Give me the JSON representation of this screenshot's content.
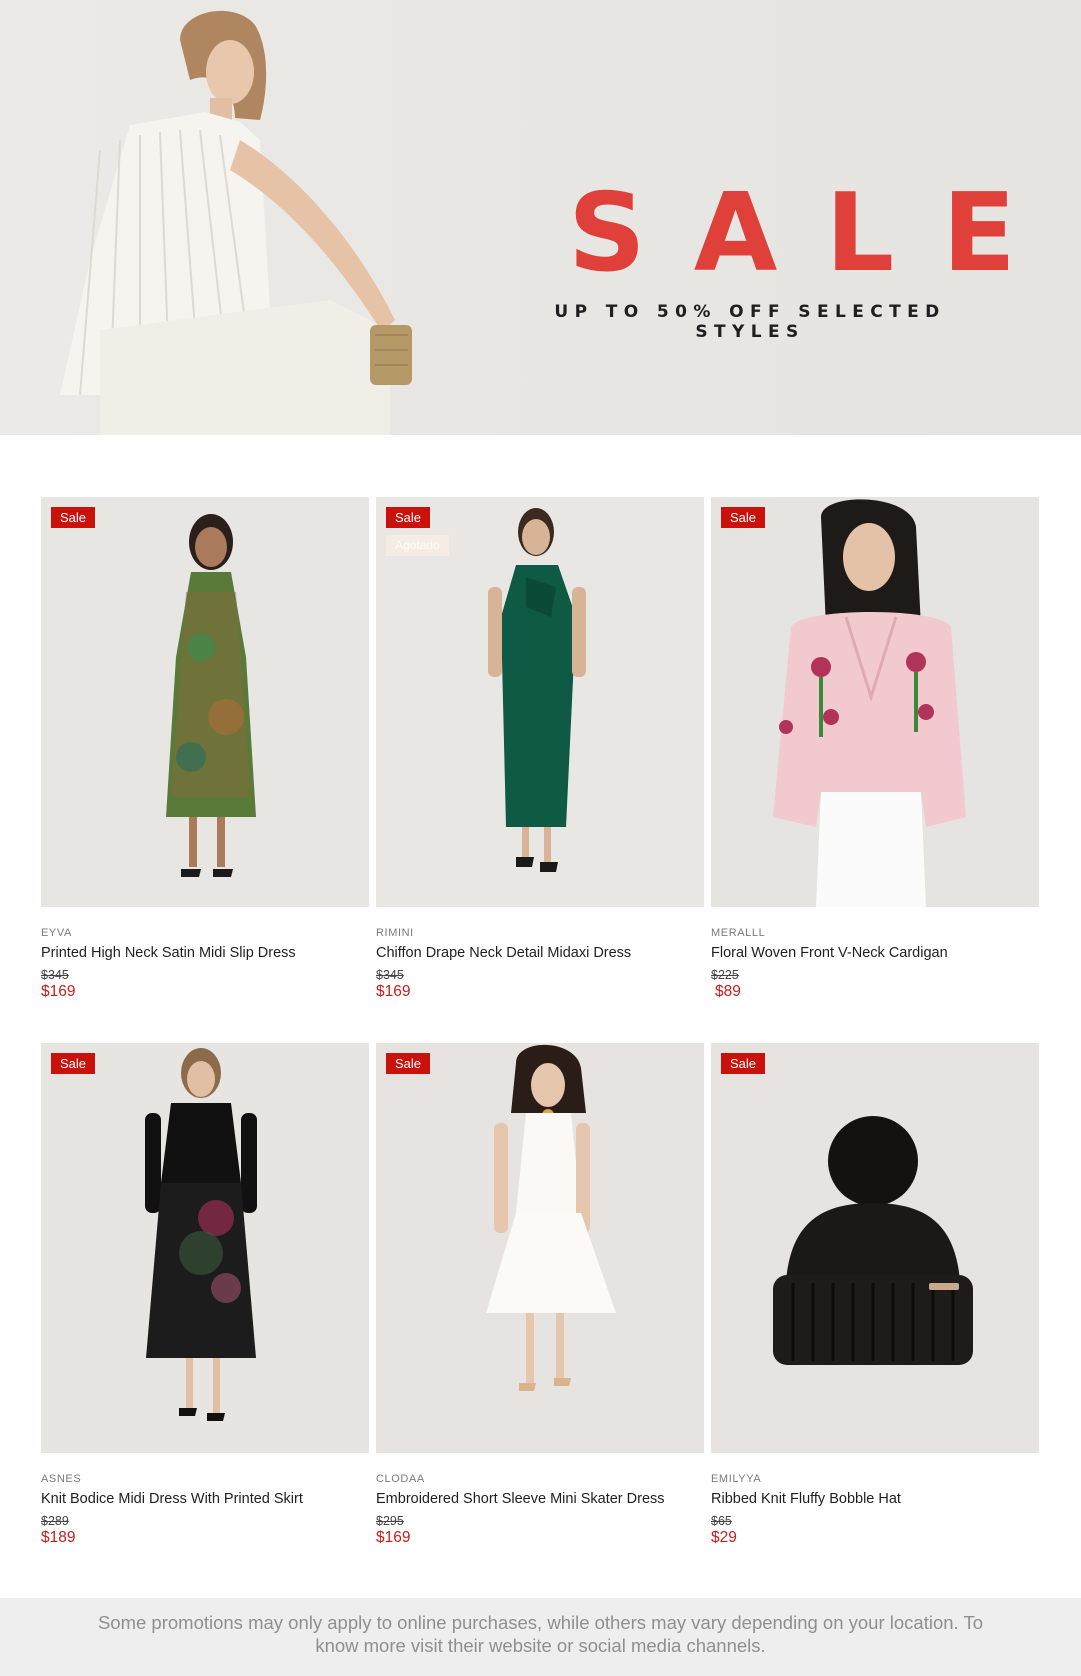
{
  "hero": {
    "title": "SALE",
    "subtitle": "UP TO 50% OFF SELECTED STYLES",
    "accent_color": "#e0403a"
  },
  "products": [
    {
      "badge": "Sale",
      "brand": "EYVA",
      "name": "Printed High Neck Satin Midi Slip Dress",
      "was_price": "$345",
      "sale_price": "$169"
    },
    {
      "badge": "Sale",
      "overlay_badge": "Agotado",
      "brand": "RIMINI",
      "name": "Chiffon Drape Neck Detail Midaxi Dress",
      "was_price": "$345",
      "sale_price": "$169"
    },
    {
      "badge": "Sale",
      "brand": "MERALLL",
      "name": "Floral Woven Front V-Neck Cardigan",
      "was_price": "$225",
      "sale_price": "$89"
    },
    {
      "badge": "Sale",
      "brand": "ASNES",
      "name": "Knit Bodice Midi Dress With Printed Skirt",
      "was_price": "$289",
      "sale_price": "$189"
    },
    {
      "badge": "Sale",
      "brand": "CLODAA",
      "name": "Embroidered Short Sleeve Mini Skater Dress",
      "was_price": "$295",
      "sale_price": "$169"
    },
    {
      "badge": "Sale",
      "brand": "EMILYYA",
      "name": "Ribbed Knit Fluffy Bobble Hat",
      "was_price": "$65",
      "sale_price": "$29"
    }
  ],
  "footer": {
    "disclaimer": "Some promotions may only apply to online purchases, while others may vary depending on your location. To know more visit their website or social media channels."
  },
  "colors": {
    "sale_badge": "#c9120c",
    "sale_price": "#c81d18",
    "image_bg": "#e7e5e2"
  }
}
